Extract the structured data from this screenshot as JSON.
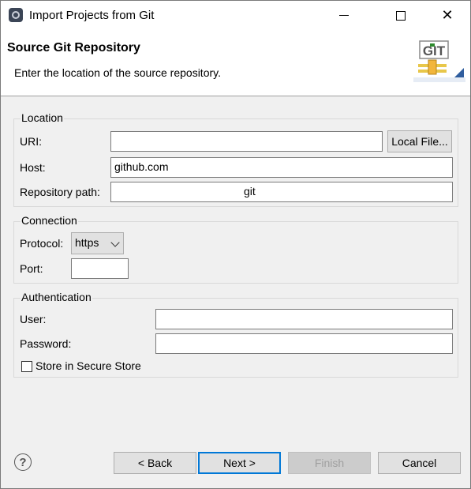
{
  "window": {
    "title": "Import Projects from Git"
  },
  "banner": {
    "title": "Source Git Repository",
    "description": "Enter the location of the source repository.",
    "logo_text": "GIT"
  },
  "location": {
    "group_label": "Location",
    "uri_label": "URI:",
    "uri_value": "",
    "local_file_button": "Local File...",
    "host_label": "Host:",
    "host_value": "github.com",
    "repo_path_label": "Repository path:",
    "repo_path_value": "git"
  },
  "connection": {
    "group_label": "Connection",
    "protocol_label": "Protocol:",
    "protocol_value": "https",
    "port_label": "Port:",
    "port_value": ""
  },
  "authentication": {
    "group_label": "Authentication",
    "user_label": "User:",
    "user_value": "",
    "password_label": "Password:",
    "password_value": "",
    "store_label": "Store in Secure Store",
    "store_checked": false
  },
  "footer": {
    "help_glyph": "?",
    "back_label": "< Back",
    "next_label": "Next >",
    "finish_label": "Finish",
    "cancel_label": "Cancel"
  },
  "icons": {
    "minimize": "minimize-icon",
    "maximize": "maximize-icon",
    "close": "close-icon",
    "help": "help-icon",
    "app": "eclipse-icon"
  }
}
